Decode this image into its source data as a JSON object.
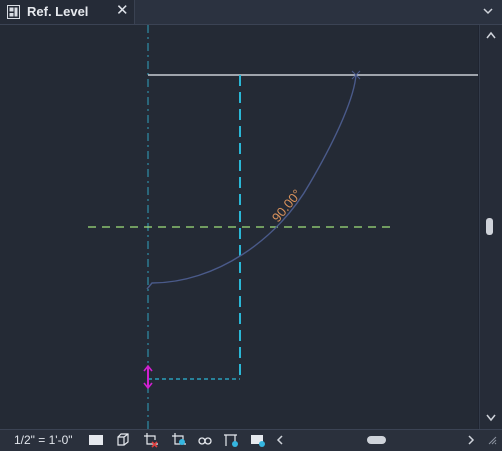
{
  "tab": {
    "title": "Ref. Level",
    "icon": "view-icon",
    "close": "✕"
  },
  "canvas": {
    "angle_label": "90.00°",
    "colors": {
      "background": "#242a35",
      "level_line": "#c8ccd4",
      "reference_plane": "#9fe07a",
      "dimension_cyan": "#2bb7d6",
      "arc": "#4a5a8a",
      "angle_text": "#d9925c",
      "grip": "#d020d0"
    }
  },
  "status": {
    "scale": "1/2\" = 1'-0\""
  }
}
